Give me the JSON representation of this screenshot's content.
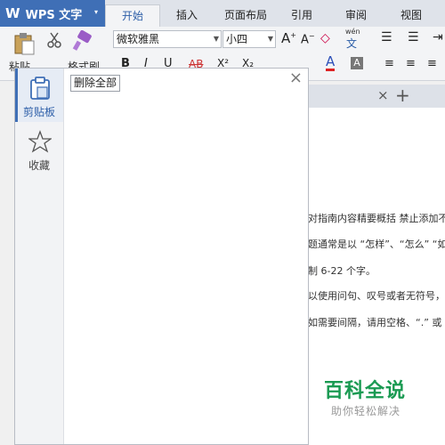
{
  "app": {
    "logo": "W",
    "name": "WPS 文字",
    "caret": "▾"
  },
  "tabs": [
    {
      "label": "开始",
      "active": true
    },
    {
      "label": "插入"
    },
    {
      "label": "页面布局"
    },
    {
      "label": "引用"
    },
    {
      "label": "审阅"
    },
    {
      "label": "视图"
    }
  ],
  "ribbon": {
    "paste_label": "粘贴",
    "format_painter_label": "格式刷",
    "font_name": "微软雅黑",
    "font_size": "小四",
    "bold": "B",
    "italic": "I",
    "underline": "U",
    "strikethrough": "AB",
    "superscript": "X²",
    "subscript": "X₂",
    "font_color": "A",
    "phonetic_top": "wén",
    "phonetic_bottom": "文"
  },
  "document": {
    "lines": [
      "对指南内容精要概括  禁止添加不",
      "题通常是以 “怎样”、“怎么” “如",
      "制 6-22 个字。",
      "以使用问句、叹号或者无符号，",
      "如需要间隔，请用空格、“.” 或"
    ],
    "new_tab_symbol": "+",
    "close_tab_symbol": "×"
  },
  "watermark": {
    "title": "百科全说",
    "subtitle": "助你轻松解决"
  },
  "clipboard_panel": {
    "sidebar": [
      {
        "label": "剪贴板",
        "icon": "clipboard-icon",
        "active": true
      },
      {
        "label": "收藏",
        "icon": "star-icon"
      }
    ],
    "clear_all_label": "删除全部",
    "close_symbol": "×"
  },
  "colors": {
    "accent": "#3f6fb6",
    "watermark_green": "#1a9a52",
    "active_tab_text": "#2c5ea8"
  }
}
